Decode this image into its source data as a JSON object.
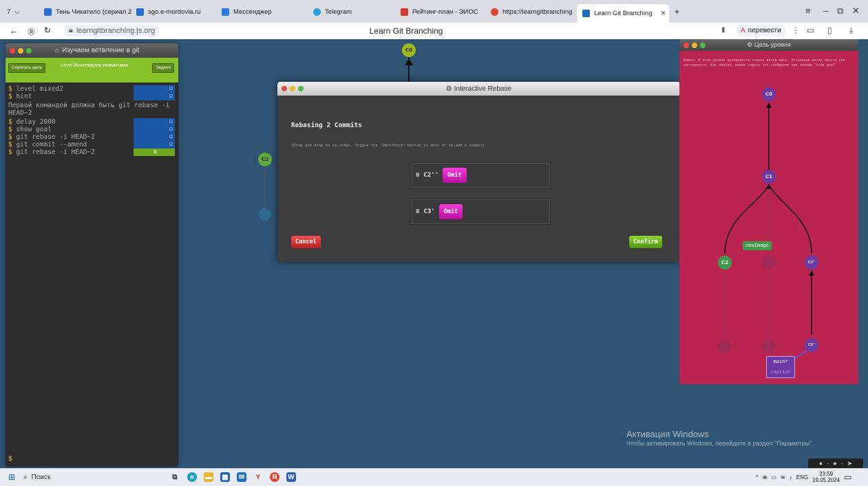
{
  "browser": {
    "tab_count": "7",
    "tabs": [
      {
        "label": "Тень Чикатило (сериал 2",
        "color": "#2b6fd6"
      },
      {
        "label": "sgo.e-mordovia.ru",
        "color": "#2b6fd6"
      },
      {
        "label": "Мессенджер",
        "color": "#2a7de1"
      },
      {
        "label": "Telegram",
        "color": "#2aa1da"
      },
      {
        "label": "Рейтинг-план - ЭИОС",
        "color": "#d23b2b"
      },
      {
        "label": "https://learngitbranching.j",
        "color": "#e0452f"
      },
      {
        "label": "Learn Git Branching",
        "color": "#1e6fb8"
      }
    ],
    "new_tab": "+",
    "url": "learngitbranching.js.org",
    "page_title": "Learn Git Branching",
    "translate_label": "перевести"
  },
  "terminal": {
    "title": "Изучаем ветвление в git",
    "objective_button": "Спрятать цель",
    "level_name": "Level Жонглируем коммитами",
    "levels_button": "Задачи",
    "commands_top": [
      {
        "text": "level mixed2",
        "mark": "☑"
      },
      {
        "text": "hint",
        "mark": "☑"
      }
    ],
    "message": "Первой командой должна быть git rebase -i HEAD~2",
    "commands": [
      {
        "text": "delay 2000",
        "mark": "☑"
      },
      {
        "text": "show goal",
        "mark": "☑"
      },
      {
        "text": "git rebase -i HEAD~2",
        "mark": "☑"
      },
      {
        "text": "git commit --amend",
        "mark": "☑"
      },
      {
        "text": "git rebase -i HEAD~2",
        "mark": "⇅"
      }
    ],
    "prompt": "$"
  },
  "canvas": {
    "nodes": [
      {
        "label": "C0",
        "color": "#9fb81e"
      },
      {
        "label": "C2",
        "color": "#5fa83a"
      }
    ]
  },
  "dialog": {
    "title": "Interactive Rebase",
    "heading": "Rebasing 2 Commits",
    "subtitle": "(Drag and drop to re-order. Toggle the \"Omit/Pick\" button to omit or re-add a commit)",
    "commits": [
      {
        "label": "C2''",
        "toggle": "Omit"
      },
      {
        "label": "C3'",
        "toggle": "Omit"
      }
    ],
    "cancel": "Cancel",
    "confirm": "Confirm"
  },
  "goal": {
    "title": "Цель уровня",
    "description": "Важно: В этом уровне проверяется только ветка main. Остальные ветки просто для наглядности. Как обычно, можно скрыть это сообщение при помощи \"hide goal\"",
    "nodes": [
      "C0",
      "C1",
      "C2",
      "C3''",
      "C2''"
    ],
    "branches": [
      "newImage",
      "main*",
      "caption"
    ]
  },
  "watermark": {
    "line1": "Активация Windows",
    "line2": "Чтобы активировать Windows, перейдите в раздел \"Параметры\"."
  },
  "taskbar": {
    "search_placeholder": "Поиск",
    "lang": "ENG",
    "time": "23:59",
    "date": "19.05.2024"
  }
}
